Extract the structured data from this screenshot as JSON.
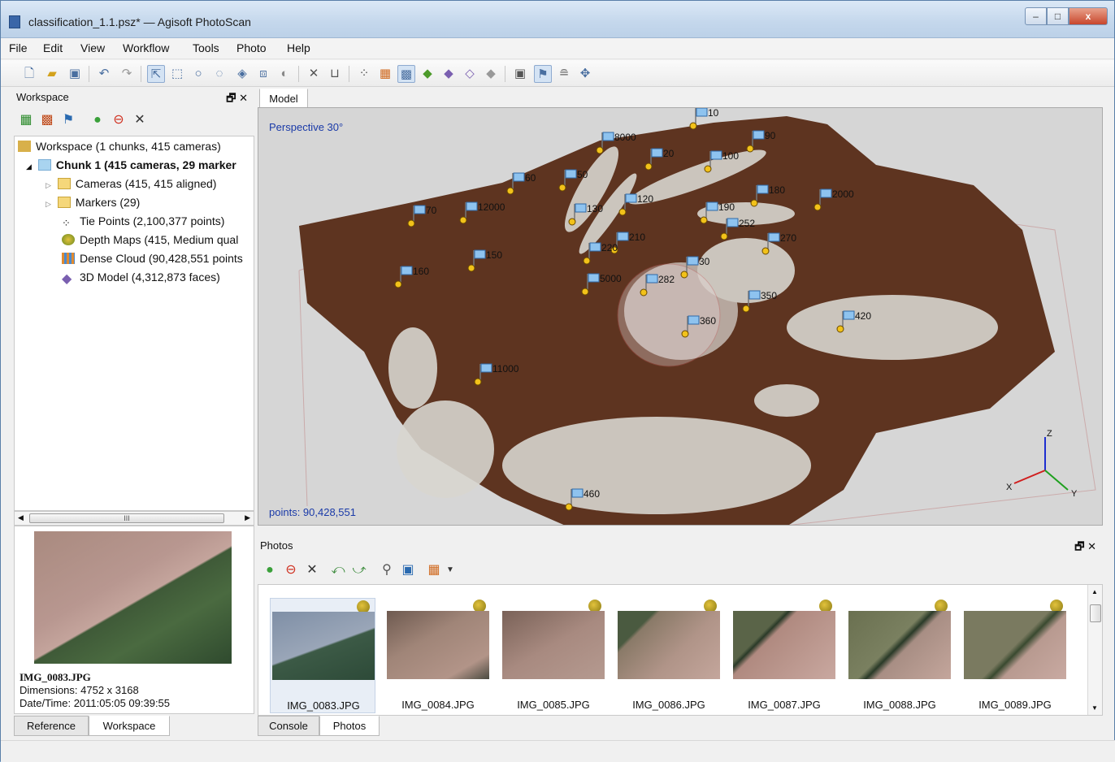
{
  "window": {
    "title": "classification_1.1.psz* — Agisoft PhotoScan"
  },
  "menu": [
    "File",
    "Edit",
    "View",
    "Workflow",
    "Tools",
    "Photo",
    "Help"
  ],
  "workspace": {
    "panel_title": "Workspace",
    "tree": [
      {
        "label": "Workspace (1 chunks, 415 cameras)",
        "icon": "workspace-icon"
      },
      {
        "label": "Chunk 1 (415 cameras, 29 marker",
        "icon": "chunk-icon",
        "bold": true
      },
      {
        "label": "Cameras (415, 415 aligned)",
        "icon": "folder-icon"
      },
      {
        "label": "Markers (29)",
        "icon": "folder-icon"
      },
      {
        "label": "Tie Points (2,100,377 points)",
        "icon": "tie-points-icon"
      },
      {
        "label": "Depth Maps (415, Medium qual",
        "icon": "depth-maps-icon"
      },
      {
        "label": "Dense Cloud (90,428,551 points",
        "icon": "dense-cloud-icon"
      },
      {
        "label": "3D Model (4,312,873 faces)",
        "icon": "mesh-icon"
      }
    ],
    "scroll_glyph": "III"
  },
  "preview": {
    "filename": "IMG_0083.JPG",
    "dimensions": "Dimensions: 4752 x 3168",
    "datetime": "Date/Time: 2011:05:05 09:39:55"
  },
  "left_tabs": [
    "Reference",
    "Workspace"
  ],
  "model": {
    "tab": "Model",
    "projection": "Perspective 30°",
    "points": "points: 90,428,551",
    "axes": {
      "x": "X",
      "y": "Y",
      "z": "Z"
    },
    "markers": [
      "10",
      "8000",
      "90",
      "20",
      "100",
      "60",
      "50",
      "180",
      "2000",
      "70",
      "12000",
      "130",
      "120",
      "190",
      "252",
      "210",
      "270",
      "150",
      "220",
      "160",
      "5000",
      "282",
      "30",
      "350",
      "360",
      "420",
      "11000",
      "460"
    ]
  },
  "photos": {
    "panel_title": "Photos",
    "items": [
      "IMG_0083.JPG",
      "IMG_0084.JPG",
      "IMG_0085.JPG",
      "IMG_0086.JPG",
      "IMG_0087.JPG",
      "IMG_0088.JPG",
      "IMG_0089.JPG"
    ]
  },
  "bottom_tabs": [
    "Console",
    "Photos"
  ],
  "colors": {
    "terrain": "#5e3420",
    "marker_dot": "#f2c21a",
    "axis_x": "#d01e1e",
    "axis_y": "#1ea01e",
    "axis_z": "#1e2ed0"
  }
}
